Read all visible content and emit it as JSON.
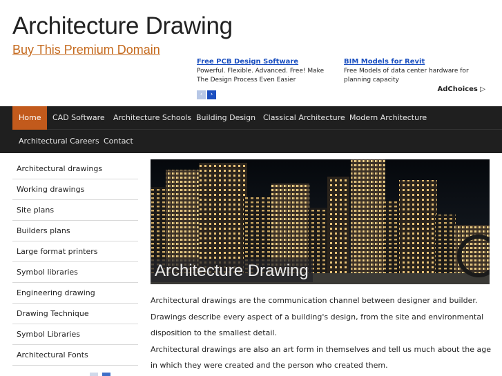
{
  "header": {
    "site_title": "Architecture Drawing",
    "domain_link": "Buy This Premium Domain"
  },
  "ads": [
    {
      "title": "Free PCB Design Software",
      "desc": "Powerful. Flexible. Advanced. Free! Make The Design Process Even Easier"
    },
    {
      "title": "BIM Models for Revit",
      "desc": "Free Models of data center hardware for planning capacity"
    }
  ],
  "ad_nav": {
    "prev_icon": "chevron-left-icon",
    "next_icon": "chevron-right-icon",
    "prev_glyph": "‹",
    "next_glyph": "›"
  },
  "adchoices": {
    "label": "AdChoices",
    "glyph": "▷"
  },
  "nav": {
    "items": [
      "Home",
      "CAD Software",
      "Architecture Schools",
      "Building Design",
      "Classical Architecture",
      "Modern Architecture",
      "Architectural Careers",
      "Contact"
    ],
    "active": "Home"
  },
  "sidebar": {
    "items": [
      "Architectural drawings",
      "Working drawings",
      "Site plans",
      "Builders plans",
      "Large format printers",
      "Symbol libraries",
      "Engineering drawing",
      "Drawing Technique",
      "Symbol Libraries",
      "Architectural Fonts"
    ]
  },
  "hero": {
    "caption": "Architecture Drawing"
  },
  "content": {
    "paragraphs": [
      "Architectural drawings are the communication channel between designer and builder. Drawings describe every aspect of a building's design, from the site and environmental disposition to the smallest detail.",
      "Architectural drawings are also an art form in themselves and tell us much about the age in which they were created and the person who created them."
    ]
  },
  "colors": {
    "accent": "#c25a1c",
    "nav_bg": "#1f1f1f",
    "link": "#c56a1e",
    "ad_link": "#1a4fc0"
  }
}
